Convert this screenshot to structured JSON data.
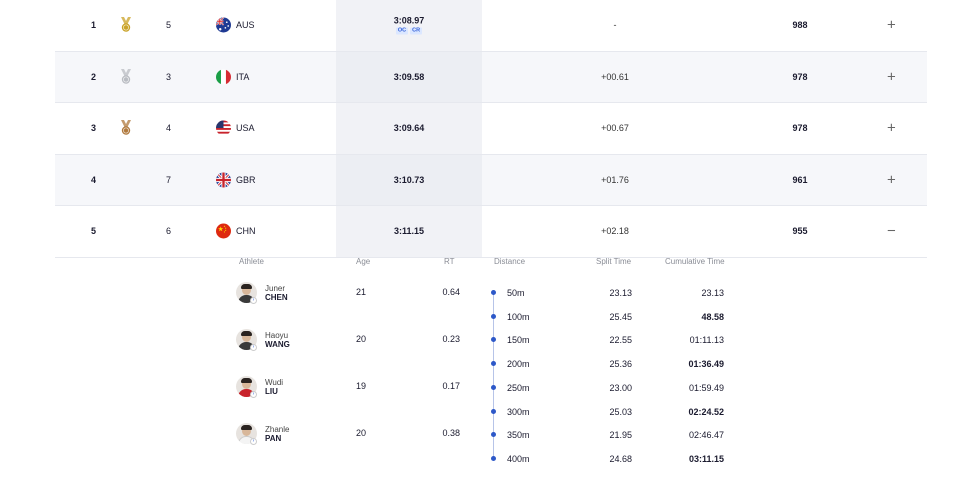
{
  "results": [
    {
      "rank": "1",
      "medal": "gold",
      "lane": "5",
      "flag": "aus",
      "noc": "AUS",
      "time": "3:08.97",
      "records": [
        "OC",
        "CR"
      ],
      "behind": "-",
      "points": "988",
      "toggle": "+"
    },
    {
      "rank": "2",
      "medal": "silver",
      "lane": "3",
      "flag": "ita",
      "noc": "ITA",
      "time": "3:09.58",
      "records": [],
      "behind": "+00.61",
      "points": "978",
      "toggle": "+"
    },
    {
      "rank": "3",
      "medal": "bronze",
      "lane": "4",
      "flag": "usa",
      "noc": "USA",
      "time": "3:09.64",
      "records": [],
      "behind": "+00.67",
      "points": "978",
      "toggle": "+"
    },
    {
      "rank": "4",
      "medal": "",
      "lane": "7",
      "flag": "gbr",
      "noc": "GBR",
      "time": "3:10.73",
      "records": [],
      "behind": "+01.76",
      "points": "961",
      "toggle": "+"
    },
    {
      "rank": "5",
      "medal": "",
      "lane": "6",
      "flag": "chn",
      "noc": "CHN",
      "time": "3:11.15",
      "records": [],
      "behind": "+02.18",
      "points": "955",
      "toggle": "−"
    }
  ],
  "detail": {
    "headers": {
      "athlete": "Athlete",
      "age": "Age",
      "rt": "RT",
      "distance": "Distance",
      "split": "Split Time",
      "cumulative": "Cumulative Time"
    },
    "athletes": [
      {
        "first": "Juner",
        "last": "CHEN",
        "age": "21",
        "rt": "0.64",
        "shirt": "dark"
      },
      {
        "first": "Haoyu",
        "last": "WANG",
        "age": "20",
        "rt": "0.23",
        "shirt": "dark"
      },
      {
        "first": "Wudi",
        "last": "LIU",
        "age": "19",
        "rt": "0.17",
        "shirt": "red"
      },
      {
        "first": "Zhanle",
        "last": "PAN",
        "age": "20",
        "rt": "0.38",
        "shirt": "white"
      }
    ],
    "splits": [
      {
        "distance": "50m",
        "split": "23.13",
        "cumulative": "23.13",
        "bold": false
      },
      {
        "distance": "100m",
        "split": "25.45",
        "cumulative": "48.58",
        "bold": true
      },
      {
        "distance": "150m",
        "split": "22.55",
        "cumulative": "01:11.13",
        "bold": false
      },
      {
        "distance": "200m",
        "split": "25.36",
        "cumulative": "01:36.49",
        "bold": true
      },
      {
        "distance": "250m",
        "split": "23.00",
        "cumulative": "01:59.49",
        "bold": false
      },
      {
        "distance": "300m",
        "split": "25.03",
        "cumulative": "02:24.52",
        "bold": true
      },
      {
        "distance": "350m",
        "split": "21.95",
        "cumulative": "02:46.47",
        "bold": false
      },
      {
        "distance": "400m",
        "split": "24.68",
        "cumulative": "03:11.15",
        "bold": true
      }
    ]
  },
  "colors": {
    "gold": "#c9a227",
    "silver": "#b9bcc2",
    "bronze": "#b0793d",
    "accent": "#2d58c8"
  }
}
